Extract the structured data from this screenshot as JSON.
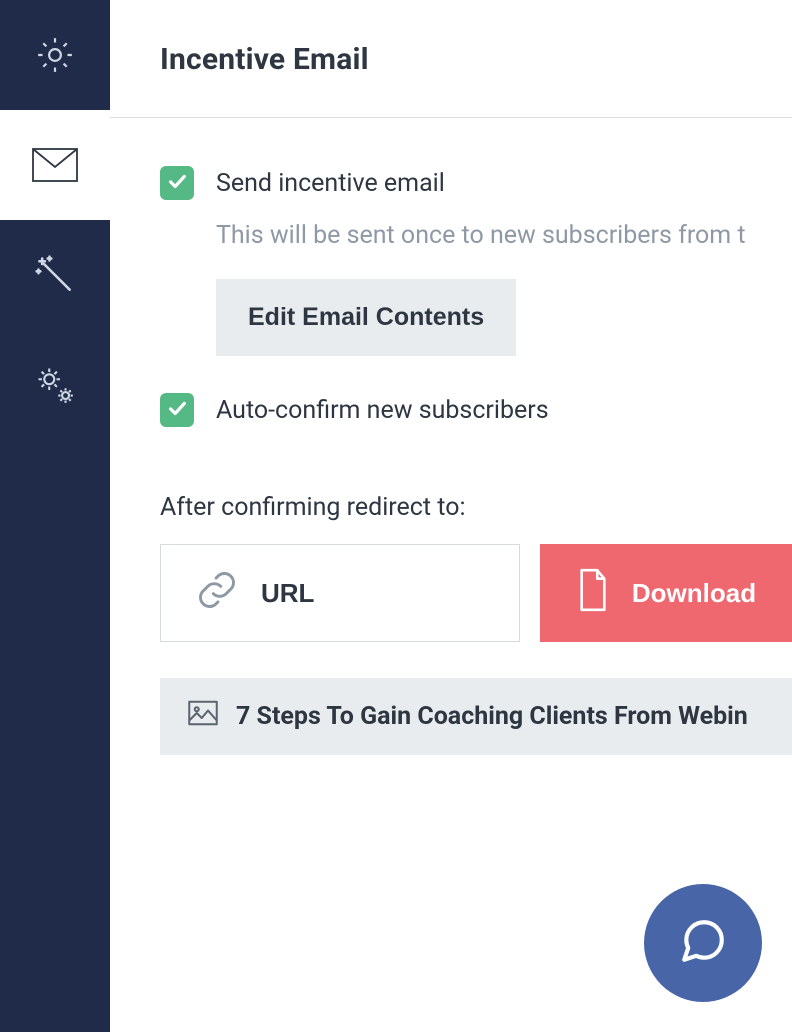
{
  "header": {
    "title": "Incentive Email"
  },
  "options": {
    "send_incentive": {
      "label": "Send incentive email",
      "description": "This will be sent once to new subscribers from t",
      "edit_button": "Edit Email Contents"
    },
    "auto_confirm": {
      "label": "Auto-confirm new subscribers"
    }
  },
  "redirect": {
    "label": "After confirming redirect to:",
    "url_label": "URL",
    "download_label": "Download",
    "file_name": "7 Steps To Gain Coaching Clients From Webin"
  }
}
